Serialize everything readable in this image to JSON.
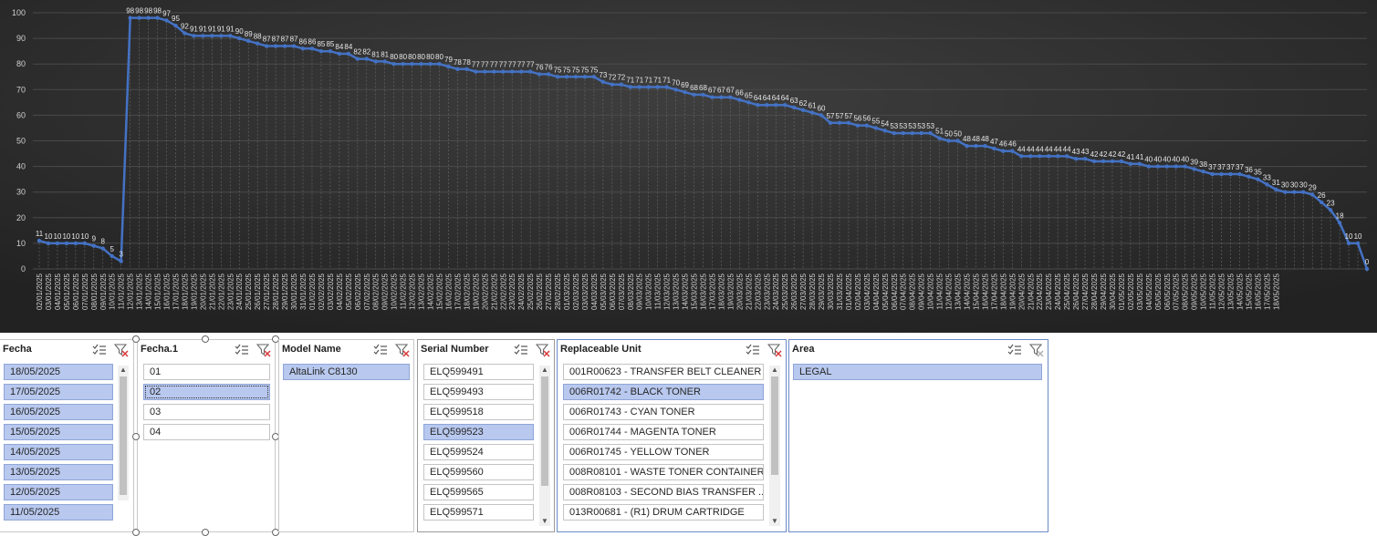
{
  "chart_data": {
    "type": "line",
    "ylim": [
      0,
      100
    ],
    "yticks": [
      "0",
      "10",
      "20",
      "30",
      "40",
      "50",
      "60",
      "70",
      "80",
      "90",
      "100"
    ],
    "x": [
      "02/01/2025",
      "03/01/2025",
      "04/01/2025",
      "05/01/2025",
      "06/01/2025",
      "07/01/2025",
      "08/01/2025",
      "09/01/2025",
      "10/01/2025",
      "11/01/2025",
      "12/01/2025",
      "13/01/2025",
      "14/01/2025",
      "15/01/2025",
      "16/01/2025",
      "17/01/2025",
      "18/01/2025",
      "19/01/2025",
      "20/01/2025",
      "21/01/2025",
      "22/01/2025",
      "23/01/2025",
      "24/01/2025",
      "25/01/2025",
      "26/01/2025",
      "27/01/2025",
      "28/01/2025",
      "29/01/2025",
      "30/01/2025",
      "31/01/2025",
      "01/02/2025",
      "02/02/2025",
      "03/02/2025",
      "04/02/2025",
      "05/02/2025",
      "06/02/2025",
      "07/02/2025",
      "08/02/2025",
      "09/02/2025",
      "10/02/2025",
      "11/02/2025",
      "12/02/2025",
      "13/02/2025",
      "14/02/2025",
      "15/02/2025",
      "16/02/2025",
      "17/02/2025",
      "18/02/2025",
      "19/02/2025",
      "20/02/2025",
      "21/02/2025",
      "22/02/2025",
      "23/02/2025",
      "24/02/2025",
      "25/02/2025",
      "26/02/2025",
      "27/02/2025",
      "28/02/2025",
      "01/03/2025",
      "02/03/2025",
      "03/03/2025",
      "04/03/2025",
      "05/03/2025",
      "06/03/2025",
      "07/03/2025",
      "08/03/2025",
      "09/03/2025",
      "10/03/2025",
      "11/03/2025",
      "12/03/2025",
      "13/03/2025",
      "14/03/2025",
      "15/03/2025",
      "16/03/2025",
      "17/03/2025",
      "18/03/2025",
      "19/03/2025",
      "20/03/2025",
      "21/03/2025",
      "22/03/2025",
      "23/03/2025",
      "24/03/2025",
      "25/03/2025",
      "26/03/2025",
      "27/03/2025",
      "28/03/2025",
      "29/03/2025",
      "30/03/2025",
      "31/03/2025",
      "01/04/2025",
      "02/04/2025",
      "03/04/2025",
      "04/04/2025",
      "05/04/2025",
      "06/04/2025",
      "07/04/2025",
      "08/04/2025",
      "09/04/2025",
      "10/04/2025",
      "11/04/2025",
      "12/04/2025",
      "13/04/2025",
      "14/04/2025",
      "15/04/2025",
      "16/04/2025",
      "17/04/2025",
      "18/04/2025",
      "19/04/2025",
      "20/04/2025",
      "21/04/2025",
      "22/04/2025",
      "23/04/2025",
      "24/04/2025",
      "25/04/2025",
      "26/04/2025",
      "27/04/2025",
      "28/04/2025",
      "29/04/2025",
      "30/04/2025",
      "01/05/2025",
      "02/05/2025",
      "03/05/2025",
      "04/05/2025",
      "05/05/2025",
      "06/05/2025",
      "07/05/2025",
      "08/05/2025",
      "09/05/2025",
      "10/05/2025",
      "11/05/2025",
      "12/05/2025",
      "13/05/2025",
      "14/05/2025",
      "15/05/2025",
      "16/05/2025",
      "17/05/2025",
      "18/05/2025"
    ],
    "values": [
      11,
      10,
      10,
      10,
      10,
      10,
      9,
      8,
      5,
      3,
      98,
      98,
      98,
      98,
      97,
      95,
      92,
      91,
      91,
      91,
      91,
      91,
      90,
      89,
      88,
      87,
      87,
      87,
      87,
      86,
      86,
      85,
      85,
      84,
      84,
      82,
      82,
      81,
      81,
      80,
      80,
      80,
      80,
      80,
      80,
      79,
      78,
      78,
      77,
      77,
      77,
      77,
      77,
      77,
      77,
      76,
      76,
      75,
      75,
      75,
      75,
      75,
      73,
      72,
      72,
      71,
      71,
      71,
      71,
      71,
      70,
      69,
      68,
      68,
      67,
      67,
      67,
      66,
      65,
      64,
      64,
      64,
      64,
      63,
      62,
      61,
      60,
      57,
      57,
      57,
      56,
      56,
      55,
      54,
      53,
      53,
      53,
      53,
      53,
      51,
      50,
      50,
      48,
      48,
      48,
      47,
      46,
      46,
      44,
      44,
      44,
      44,
      44,
      44,
      43,
      43,
      42,
      42,
      42,
      42,
      41,
      41,
      40,
      40,
      40,
      40,
      40,
      39,
      38,
      37,
      37,
      37,
      37,
      36,
      35,
      33,
      31,
      30,
      30,
      30,
      29,
      26,
      23,
      18,
      10,
      10,
      0
    ],
    "line_color": "#4472c4",
    "background": "#2b2b2b",
    "grid": true
  },
  "slicers": {
    "fecha": {
      "title": "Fecha",
      "items": [
        {
          "label": "18/05/2025",
          "selected": true
        },
        {
          "label": "17/05/2025",
          "selected": true
        },
        {
          "label": "16/05/2025",
          "selected": true
        },
        {
          "label": "15/05/2025",
          "selected": true
        },
        {
          "label": "14/05/2025",
          "selected": true
        },
        {
          "label": "13/05/2025",
          "selected": true
        },
        {
          "label": "12/05/2025",
          "selected": true
        },
        {
          "label": "11/05/2025",
          "selected": true
        }
      ]
    },
    "fecha1": {
      "title": "Fecha.1",
      "items": [
        {
          "label": "01",
          "selected": false
        },
        {
          "label": "02",
          "selected": true
        },
        {
          "label": "03",
          "selected": false
        },
        {
          "label": "04",
          "selected": false
        }
      ]
    },
    "model": {
      "title": "Model Name",
      "items": [
        {
          "label": "AltaLink C8130",
          "selected": true
        }
      ]
    },
    "serial": {
      "title": "Serial Number",
      "items": [
        {
          "label": "ELQ599491",
          "selected": false
        },
        {
          "label": "ELQ599493",
          "selected": false
        },
        {
          "label": "ELQ599518",
          "selected": false
        },
        {
          "label": "ELQ599523",
          "selected": true
        },
        {
          "label": "ELQ599524",
          "selected": false
        },
        {
          "label": "ELQ599560",
          "selected": false
        },
        {
          "label": "ELQ599565",
          "selected": false
        },
        {
          "label": "ELQ599571",
          "selected": false
        }
      ]
    },
    "unit": {
      "title": "Replaceable Unit",
      "items": [
        {
          "label": "001R00623 - TRANSFER BELT CLEANER",
          "selected": false
        },
        {
          "label": "006R01742 - BLACK TONER",
          "selected": true
        },
        {
          "label": "006R01743 - CYAN TONER",
          "selected": false
        },
        {
          "label": "006R01744 - MAGENTA TONER",
          "selected": false
        },
        {
          "label": "006R01745 - YELLOW TONER",
          "selected": false
        },
        {
          "label": "008R08101 - WASTE TONER CONTAINER",
          "selected": false
        },
        {
          "label": "008R08103 - SECOND BIAS TRANSFER ...",
          "selected": false
        },
        {
          "label": "013R00681 - (R1) DRUM CARTRIDGE",
          "selected": false
        }
      ]
    },
    "area": {
      "title": "Area",
      "items": [
        {
          "label": "LEGAL",
          "selected": true
        }
      ]
    }
  },
  "icons": {
    "multiselect": "multi-select-icon",
    "clear_filter": "clear-filter-icon"
  }
}
